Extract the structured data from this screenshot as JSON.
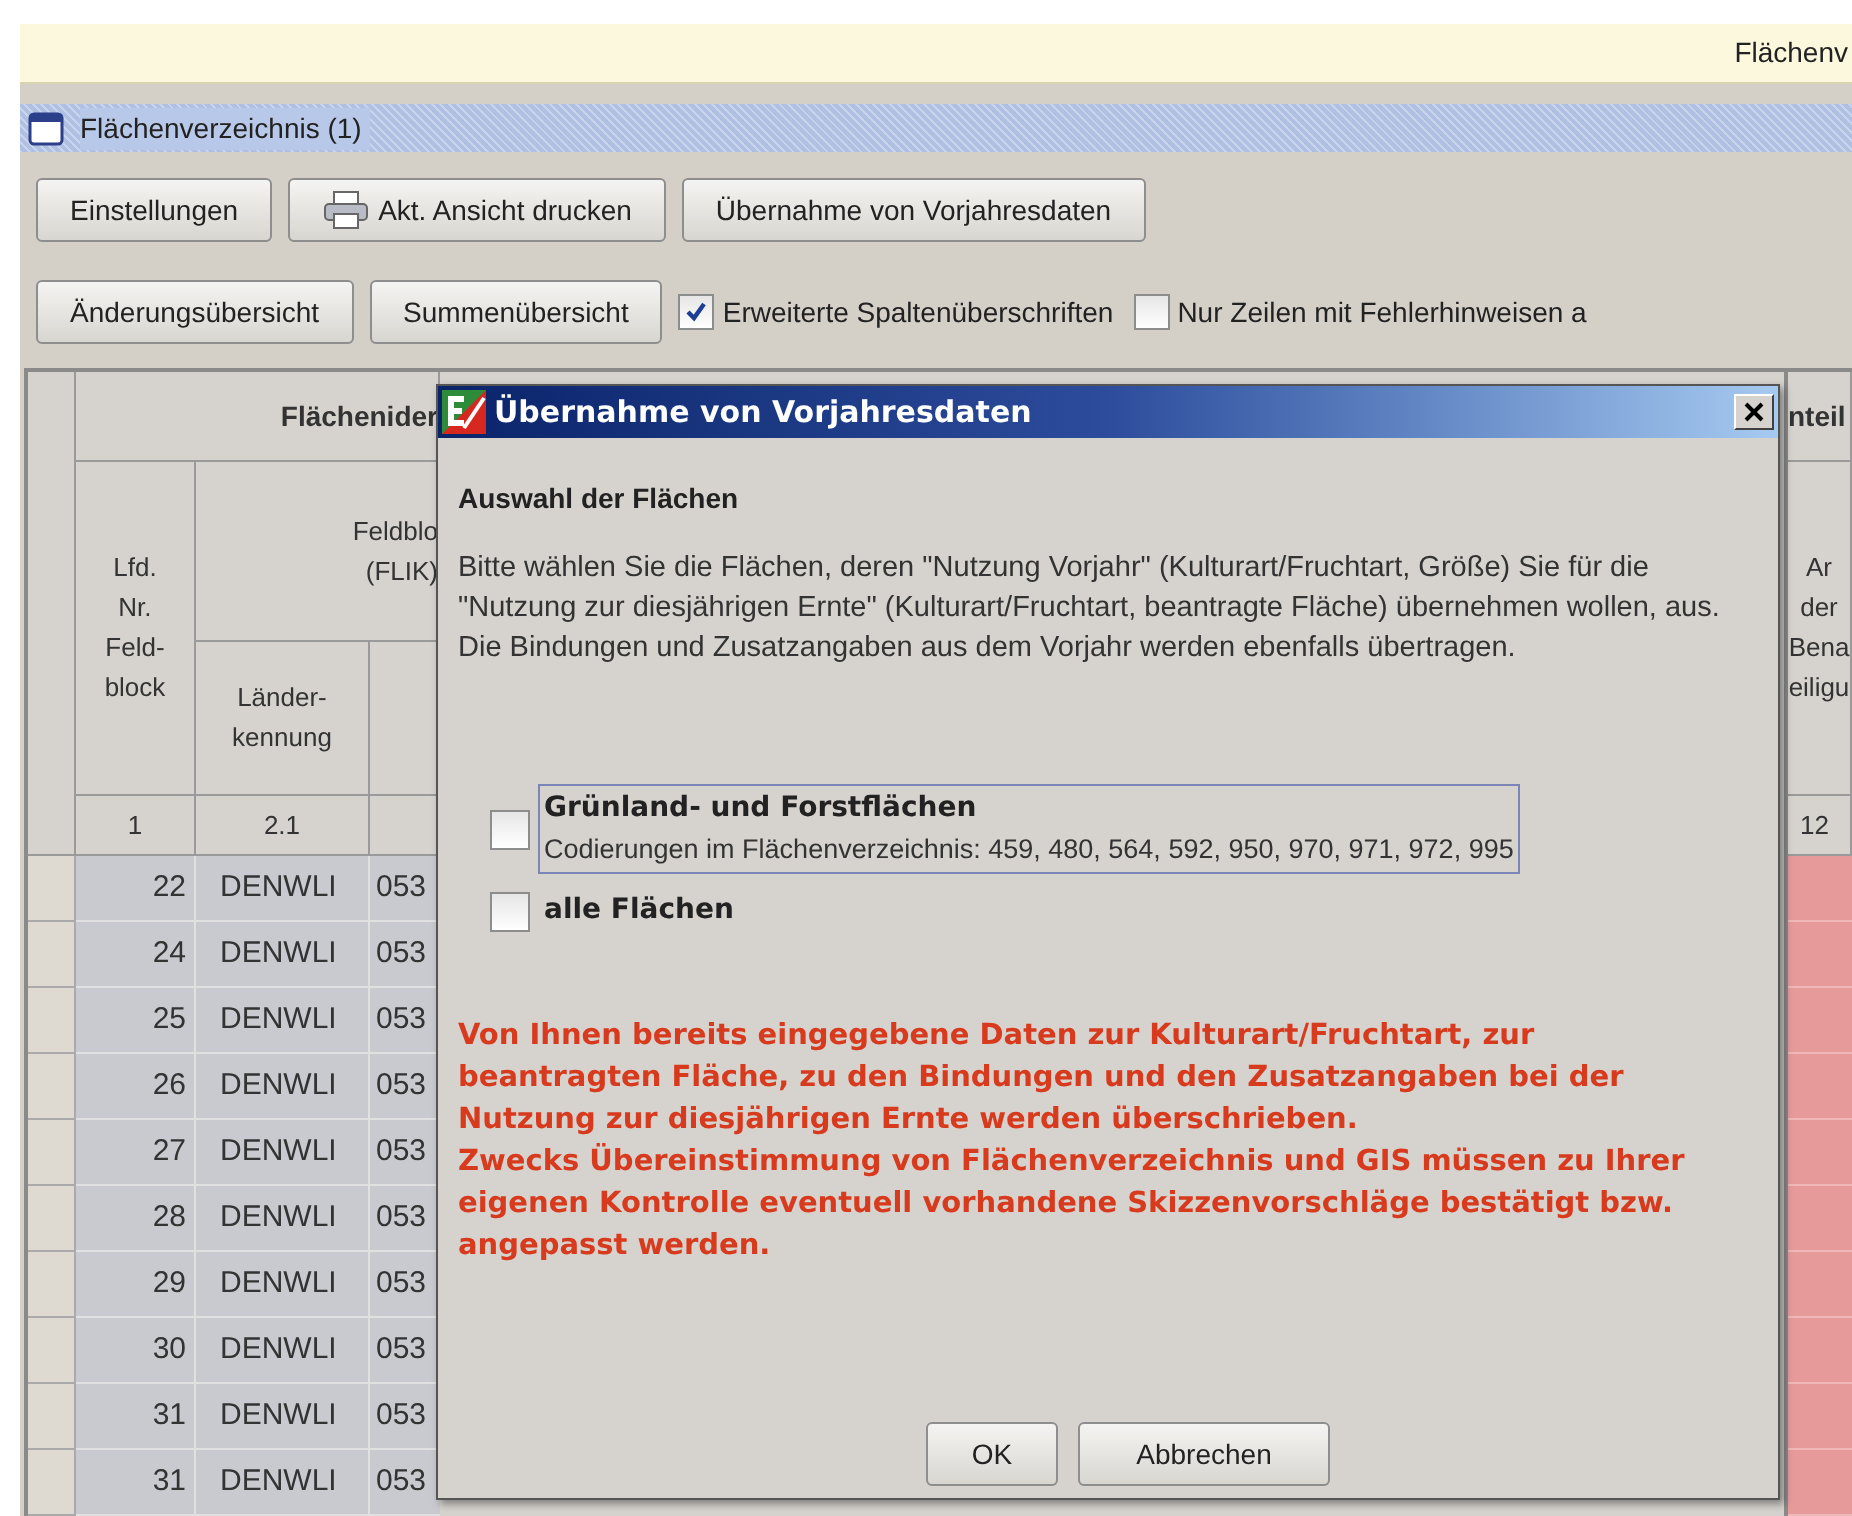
{
  "app_header": {
    "title": "Flächenv"
  },
  "window": {
    "title": "Flächenverzeichnis (1)"
  },
  "toolbar_1": [
    {
      "label": "Einstellungen",
      "kind": "plain"
    },
    {
      "label": "Akt. Ansicht drucken",
      "kind": "printer"
    },
    {
      "label": "Übernahme von Vorjahresdaten",
      "kind": "plain"
    }
  ],
  "toolbar_2": {
    "buttons": [
      "Änderungsübersicht",
      "Summenübersicht"
    ],
    "checkboxes": [
      {
        "label": "Erweiterte Spaltenüberschriften",
        "checked": true
      },
      {
        "label": "Nur Zeilen mit Fehlerhinweisen a",
        "checked": false
      }
    ]
  },
  "table": {
    "group_header": "Flächenider",
    "right_group_header": "nteil",
    "lfd_header": [
      "Lfd.",
      "Nr.",
      "Feld-",
      "block"
    ],
    "feldblock_header": [
      "Feldblo",
      "(FLIK)"
    ],
    "land_header": [
      "Länder-",
      "kennung"
    ],
    "right_header": [
      "Ar",
      "der",
      "Bena",
      "eiligu"
    ],
    "column_numbers": [
      "1",
      "2.1",
      "12"
    ],
    "rows": [
      {
        "lfd": "22",
        "land": "DENWLI",
        "flik": "053"
      },
      {
        "lfd": "24",
        "land": "DENWLI",
        "flik": "053"
      },
      {
        "lfd": "25",
        "land": "DENWLI",
        "flik": "053"
      },
      {
        "lfd": "26",
        "land": "DENWLI",
        "flik": "053"
      },
      {
        "lfd": "27",
        "land": "DENWLI",
        "flik": "053"
      },
      {
        "lfd": "28",
        "land": "DENWLI",
        "flik": "053"
      },
      {
        "lfd": "29",
        "land": "DENWLI",
        "flik": "053"
      },
      {
        "lfd": "30",
        "land": "DENWLI",
        "flik": "053"
      },
      {
        "lfd": "31",
        "land": "DENWLI",
        "flik": "053"
      },
      {
        "lfd": "31",
        "land": "DENWLI",
        "flik": "053"
      }
    ]
  },
  "dialog": {
    "title": "Übernahme von Vorjahresdaten",
    "heading": "Auswahl der Flächen",
    "description": "Bitte wählen Sie die Flächen, deren \"Nutzung Vorjahr\" (Kulturart/Fruchtart, Größe) Sie für die \"Nutzung zur diesjährigen Ernte\" (Kulturart/Fruchtart, beantragte Fläche) übernehmen wollen, aus. Die Bindungen und Zusatzangaben aus dem Vorjahr werden ebenfalls übertragen.",
    "options": [
      {
        "label": "Grünland- und Forstflächen",
        "detail": "Codierungen im Flächenverzeichnis: 459, 480, 564, 592, 950, 970, 971, 972, 995",
        "checked": false,
        "focused": true
      },
      {
        "label": "alle Flächen",
        "checked": false,
        "focused": false
      }
    ],
    "warnings": [
      "Von Ihnen bereits eingegebene Daten zur Kulturart/Fruchtart, zur beantragten Fläche, zu den Bindungen und den Zusatzangaben bei der Nutzung zur diesjährigen Ernte werden überschrieben.",
      "Zwecks Übereinstimmung von Flächenverzeichnis und GIS müssen zu Ihrer eigenen Kontrolle eventuell vorhandene Skizzenvorschläge bestätigt bzw. angepasst werden."
    ],
    "buttons": [
      "OK",
      "Abbrechen"
    ]
  }
}
